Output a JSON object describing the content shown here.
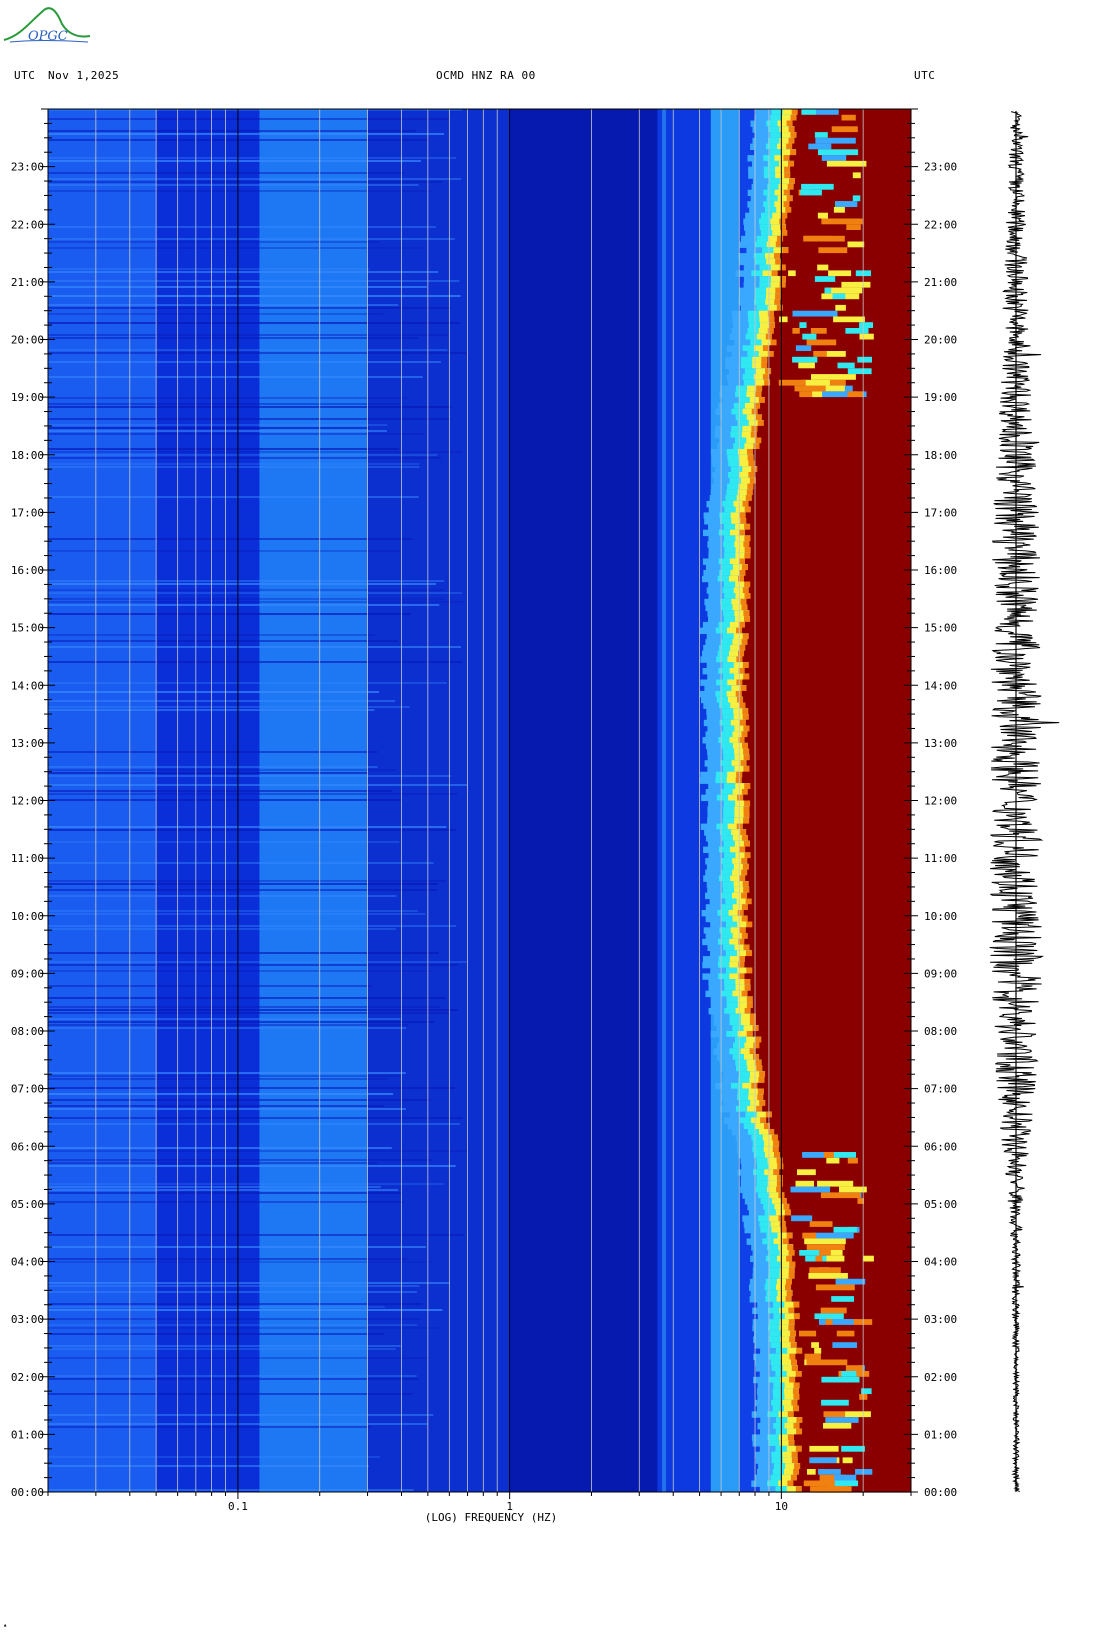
{
  "header": {
    "left_utc": "UTC",
    "date": "Nov 1,2025",
    "station": "OCMD HNZ RA 00",
    "right_utc": "UTC"
  },
  "logo": {
    "text": "OPGC"
  },
  "colors": {
    "deep_blue": "#0010a8",
    "blue": "#1040e8",
    "light_blue": "#3aa8ff",
    "cyan": "#30e8f0",
    "yellow": "#f8f040",
    "orange": "#f08010",
    "dark_red": "#8a0000"
  },
  "chart_data": {
    "type": "heatmap",
    "title": "OCMD HNZ RA 00",
    "xlabel": "(LOG) FREQUENCY (HZ)",
    "x_scale": "log",
    "xlim": [
      0.02,
      30
    ],
    "x_ticks": [
      {
        "value": 0.1,
        "label": "0.1"
      },
      {
        "value": 1,
        "label": "1"
      },
      {
        "value": 10,
        "label": "10"
      }
    ],
    "ylabel_left": "UTC",
    "ylabel_right": "UTC",
    "y_ticks": [
      "00:00",
      "01:00",
      "02:00",
      "03:00",
      "04:00",
      "05:00",
      "06:00",
      "07:00",
      "08:00",
      "09:00",
      "10:00",
      "11:00",
      "12:00",
      "13:00",
      "14:00",
      "15:00",
      "16:00",
      "17:00",
      "18:00",
      "19:00",
      "20:00",
      "21:00",
      "22:00",
      "23:00"
    ],
    "ylim_hours": [
      0,
      24
    ],
    "red_onset_hz_by_hour": [
      {
        "hour": 0,
        "hz": 11.5
      },
      {
        "hour": 3,
        "hz": 11.5
      },
      {
        "hour": 5,
        "hz": 10.5
      },
      {
        "hour": 6,
        "hz": 9.5
      },
      {
        "hour": 7,
        "hz": 8.5
      },
      {
        "hour": 9,
        "hz": 7.6
      },
      {
        "hour": 12,
        "hz": 7.4
      },
      {
        "hour": 15,
        "hz": 7.4
      },
      {
        "hour": 17,
        "hz": 7.6
      },
      {
        "hour": 19,
        "hz": 8.5
      },
      {
        "hour": 20,
        "hz": 9.5
      },
      {
        "hour": 22,
        "hz": 10.5
      },
      {
        "hour": 24,
        "hz": 11.5
      }
    ],
    "bands": [
      {
        "from_hz": 0.02,
        "to_hz": 0.05,
        "color": "#1a5cf0"
      },
      {
        "from_hz": 0.05,
        "to_hz": 0.12,
        "color": "#0a2ed8"
      },
      {
        "from_hz": 0.12,
        "to_hz": 0.3,
        "color": "#1e78f4"
      },
      {
        "from_hz": 0.3,
        "to_hz": 1.0,
        "color": "#0c30d0"
      },
      {
        "from_hz": 1.0,
        "to_hz": 3.5,
        "color": "#061ab0"
      },
      {
        "from_hz": 3.5,
        "to_hz": 5.5,
        "color": "#0c3ae0"
      },
      {
        "from_hz": 5.5,
        "to_hz": 7.0,
        "color": "#2a9cf8"
      }
    ]
  },
  "seismogram": {
    "max_amplitude_by_hour": [
      {
        "hour": 0,
        "amp": 0.1
      },
      {
        "hour": 2,
        "amp": 0.08
      },
      {
        "hour": 4,
        "amp": 0.12
      },
      {
        "hour": 5,
        "amp": 0.22
      },
      {
        "hour": 6,
        "amp": 0.4
      },
      {
        "hour": 7,
        "amp": 0.55
      },
      {
        "hour": 9,
        "amp": 0.75
      },
      {
        "hour": 12,
        "amp": 0.7
      },
      {
        "hour": 15,
        "amp": 0.7
      },
      {
        "hour": 17,
        "amp": 0.65
      },
      {
        "hour": 19,
        "amp": 0.45
      },
      {
        "hour": 21,
        "amp": 0.35
      },
      {
        "hour": 23,
        "amp": 0.22
      },
      {
        "hour": 24,
        "amp": 0.15
      }
    ]
  }
}
